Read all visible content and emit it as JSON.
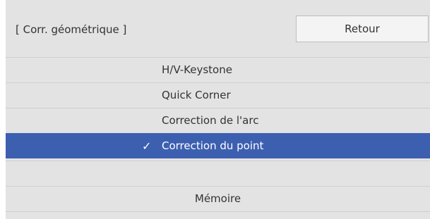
{
  "header": {
    "title": "[ Corr. géométrique ]",
    "back_label": "Retour"
  },
  "menu": {
    "items": [
      {
        "label": "H/V-Keystone",
        "selected": false
      },
      {
        "label": "Quick Corner",
        "selected": false
      },
      {
        "label": "Correction de l'arc",
        "selected": false
      },
      {
        "label": "Correction du point",
        "selected": true
      }
    ],
    "memory_label": "Mémoire",
    "check_icon": "check-icon"
  },
  "colors": {
    "panel_bg": "#e3e3e3",
    "selected_bg": "#3c5fb0",
    "button_bg": "#f4f4f4",
    "text": "#333333"
  }
}
